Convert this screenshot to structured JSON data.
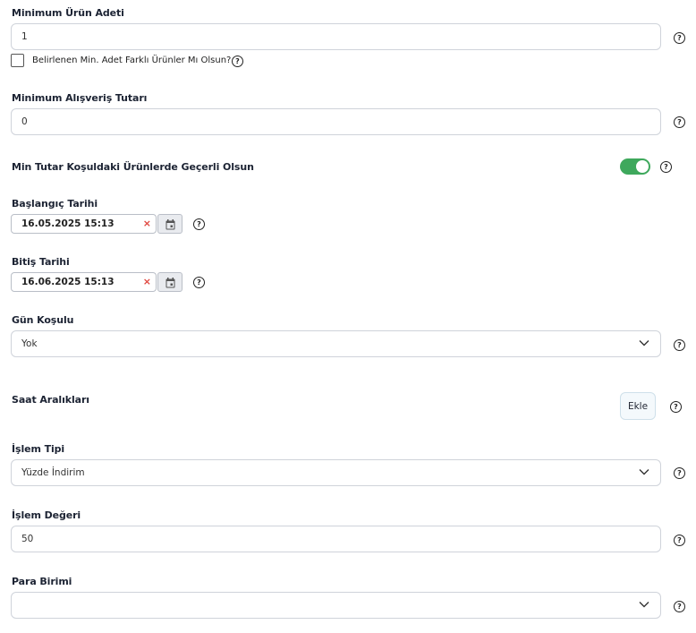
{
  "min_qty": {
    "label": "Minimum Ürün Adeti",
    "value": "1"
  },
  "diff_products": {
    "label": "Belirlenen Min. Adet Farklı Ürünler Mı Olsun?",
    "checked": false
  },
  "min_amount": {
    "label": "Minimum Alışveriş Tutarı",
    "value": "0"
  },
  "min_cond_toggle": {
    "label": "Min Tutar Koşuldaki Ürünlerde Geçerli Olsun",
    "on": true,
    "color": "#3ea85c"
  },
  "start_date": {
    "label": "Başlangıç Tarihi",
    "value": "16.05.2025 15:13",
    "clear": "×"
  },
  "end_date": {
    "label": "Bitiş Tarihi",
    "value": "16.06.2025 15:13",
    "clear": "×"
  },
  "day_cond": {
    "label": "Gün Koşulu",
    "value": "Yok"
  },
  "time_ranges": {
    "label": "Saat Aralıkları",
    "button": "Ekle"
  },
  "op_type": {
    "label": "İşlem Tipi",
    "value": "Yüzde İndirim"
  },
  "op_value": {
    "label": "İşlem Değeri",
    "value": "50"
  },
  "currency": {
    "label": "Para Birimi",
    "value": ""
  },
  "help_glyph": "?",
  "icons": [
    "help-icon",
    "calendar-icon",
    "chevron-down-icon",
    "clear-icon"
  ]
}
